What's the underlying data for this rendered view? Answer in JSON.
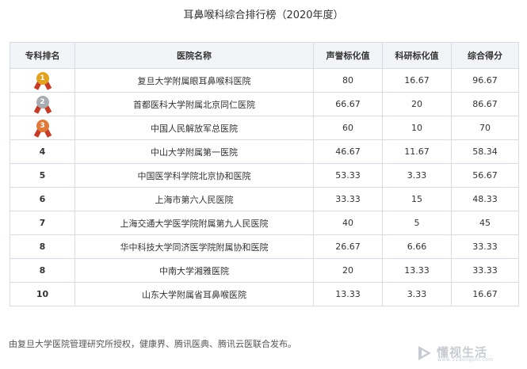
{
  "title": "耳鼻喉科综合排行榜（2020年度）",
  "table": {
    "headers": [
      "专科排名",
      "医院名称",
      "声誉标化值",
      "科研标化值",
      "综合得分"
    ],
    "rows": [
      {
        "rank": "",
        "medal": "1",
        "name": "复旦大学附属眼耳鼻喉科医院",
        "reputation": "80",
        "research": "16.67",
        "score": "96.67"
      },
      {
        "rank": "",
        "medal": "2",
        "name": "首都医科大学附属北京同仁医院",
        "reputation": "66.67",
        "research": "20",
        "score": "86.67"
      },
      {
        "rank": "",
        "medal": "3",
        "name": "中国人民解放军总医院",
        "reputation": "60",
        "research": "10",
        "score": "70"
      },
      {
        "rank": "4",
        "medal": "",
        "name": "中山大学附属第一医院",
        "reputation": "46.67",
        "research": "11.67",
        "score": "58.34"
      },
      {
        "rank": "5",
        "medal": "",
        "name": "中国医学科学院北京协和医院",
        "reputation": "53.33",
        "research": "3.33",
        "score": "56.67"
      },
      {
        "rank": "6",
        "medal": "",
        "name": "上海市第六人民医院",
        "reputation": "33.33",
        "research": "15",
        "score": "48.33"
      },
      {
        "rank": "7",
        "medal": "",
        "name": "上海交通大学医学院附属第九人民医院",
        "reputation": "40",
        "research": "5",
        "score": "45"
      },
      {
        "rank": "8",
        "medal": "",
        "name": "华中科技大学同济医学院附属协和医院",
        "reputation": "26.67",
        "research": "6.66",
        "score": "33.33"
      },
      {
        "rank": "8",
        "medal": "",
        "name": "中南大学湘雅医院",
        "reputation": "20",
        "research": "13.33",
        "score": "33.33"
      },
      {
        "rank": "10",
        "medal": "",
        "name": "山东大学附属省耳鼻喉医院",
        "reputation": "13.33",
        "research": "3.33",
        "score": "16.67"
      }
    ]
  },
  "medal_colors": {
    "1": "#e0a21f",
    "2": "#a9acb1",
    "3": "#e07a3a"
  },
  "footer": "由复旦大学医院管理研究所授权，健康界、腾讯医典、腾讯云医联合发布。",
  "logo": {
    "icon": "play-triangle-icon",
    "name": "懂视生活",
    "url": "www.51dongshi.com"
  }
}
